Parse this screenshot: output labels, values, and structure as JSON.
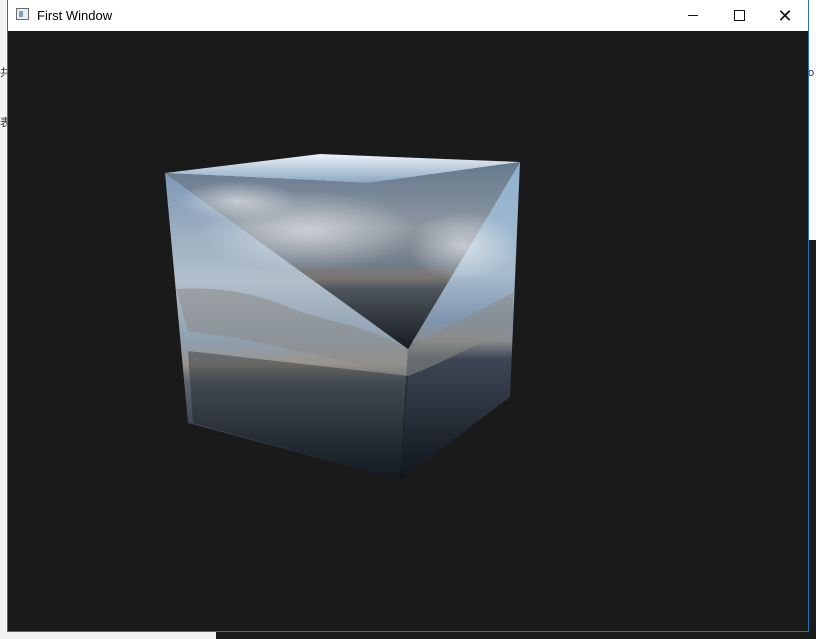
{
  "window": {
    "title": "First Window"
  },
  "titlebar": {
    "minimize": "minimize",
    "maximize": "maximize",
    "close": "close"
  },
  "scene": {
    "object": "cube",
    "texture": "skybox mountains lake",
    "background_color": "#1a1a1a"
  },
  "background_glyphs": {
    "left1": "共",
    "left2": "表",
    "right1": "o"
  }
}
